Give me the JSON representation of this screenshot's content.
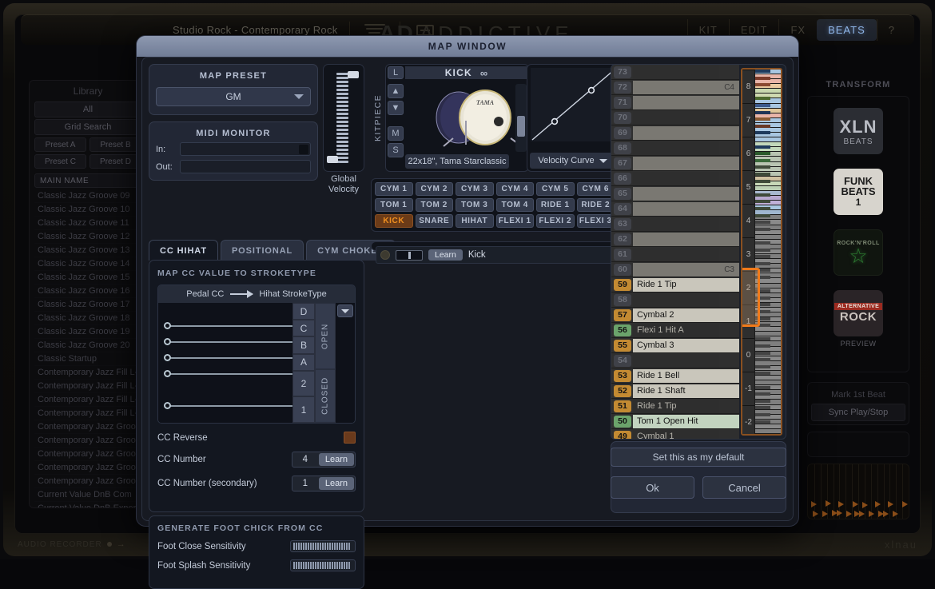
{
  "host_app": {
    "title": "Studio Rock - Contemporary Rock",
    "logo": "ADDICTIVE",
    "nav_tabs": [
      {
        "label": "KIT",
        "active": false
      },
      {
        "label": "EDIT",
        "active": false
      },
      {
        "label": "FX",
        "active": false
      },
      {
        "label": "BEATS",
        "active": true
      },
      {
        "label": "?",
        "active": false
      }
    ],
    "library": {
      "head": "Library",
      "all_button": "All",
      "grid_search": "Grid Search",
      "presets": [
        "Preset A",
        "Preset B",
        "Preset C",
        "Preset D"
      ],
      "column_header": "MAIN NAME",
      "items": [
        "Classic Jazz Groove 09",
        "Classic Jazz Groove 10",
        "Classic Jazz Groove 11",
        "Classic Jazz Groove 12",
        "Classic Jazz Groove 13",
        "Classic Jazz Groove 14",
        "Classic Jazz Groove 15",
        "Classic Jazz Groove 16",
        "Classic Jazz Groove 17",
        "Classic Jazz Groove 18",
        "Classic Jazz Groove 19",
        "Classic Jazz Groove 20",
        "Classic Startup",
        "Contemporary Jazz Fill L-",
        "Contemporary Jazz Fill L-",
        "Contemporary Jazz Fill L-",
        "Contemporary Jazz Fill L-",
        "Contemporary Jazz Groo",
        "Contemporary Jazz Groo",
        "Contemporary Jazz Groo",
        "Contemporary Jazz Groo",
        "Contemporary Jazz Groo",
        "Current Value DnB Com",
        "Current Value DnB Exper"
      ]
    },
    "transform": {
      "head": "TRANSFORM",
      "tiles": [
        {
          "line1": "XLN",
          "line2": "BEATS",
          "caption": ""
        },
        {
          "line1": "FUNK",
          "line2": "BEATS",
          "line3": "1",
          "caption": ""
        },
        {
          "line1": "ROCK'N'ROLL",
          "line2": "",
          "caption": ""
        },
        {
          "line1": "ALTERNATIVE",
          "line2": "ROCK",
          "caption": "PREVIEW"
        }
      ],
      "buttons": [
        "Mark 1st Beat",
        "Sync Play/Stop"
      ]
    },
    "statusbar": {
      "left": "AUDIO RECORDER",
      "right": "xlnau"
    }
  },
  "modal": {
    "title": "MAP WINDOW",
    "map_preset": {
      "title": "MAP PRESET",
      "selected": "GM"
    },
    "midi_monitor": {
      "title": "MIDI MONITOR",
      "in_label": "In:",
      "out_label": "Out:",
      "in_value": "",
      "out_value": ""
    },
    "global_velocity": {
      "label_line1": "Global",
      "label_line2": "Velocity"
    },
    "tabs": [
      {
        "label": "CC HIHAT",
        "active": true
      },
      {
        "label": "POSITIONAL",
        "active": false
      },
      {
        "label": "CYM CHOKES",
        "active": false
      }
    ],
    "cc_hihat": {
      "section_title": "MAP CC VALUE TO STROKETYPE",
      "header_left": "Pedal CC",
      "header_right": "Hihat StrokeType",
      "stroke_labels": [
        "D",
        "C",
        "B",
        "A",
        "2",
        "1"
      ],
      "group_open": "OPEN",
      "group_closed": "CLOSED",
      "cc_reverse_label": "CC Reverse",
      "cc_reverse_checked": true,
      "cc_number_label": "CC Number",
      "cc_number_value": "4",
      "cc_number_learn": "Learn",
      "cc_number_secondary_label": "CC Number (secondary)",
      "cc_number_secondary_value": "1",
      "cc_number_secondary_learn": "Learn"
    },
    "foot_chick": {
      "section_title": "GENERATE FOOT CHICK FROM CC",
      "rows": [
        {
          "label": "Foot Close Sensitivity"
        },
        {
          "label": "Foot Splash Sensitivity"
        }
      ]
    },
    "kitpiece": {
      "side_label": "KITPIECE",
      "name": "KICK",
      "caption": "22x18\", Tama Starclassic",
      "btn_l": "L",
      "btn_m": "M",
      "btn_s": "S"
    },
    "velocity_curve": {
      "label": "Velocity Curve"
    },
    "kit_grid": [
      [
        {
          "label": "CYM 1",
          "selected": false
        },
        {
          "label": "CYM 2",
          "selected": false
        },
        {
          "label": "CYM 3",
          "selected": false
        },
        {
          "label": "CYM 4",
          "selected": false
        },
        {
          "label": "CYM 5",
          "selected": false
        },
        {
          "label": "CYM 6",
          "selected": false
        }
      ],
      [
        {
          "label": "TOM 1",
          "selected": false
        },
        {
          "label": "TOM 2",
          "selected": false
        },
        {
          "label": "TOM 3",
          "selected": false
        },
        {
          "label": "TOM 4",
          "selected": false
        },
        {
          "label": "RIDE 1",
          "selected": false
        },
        {
          "label": "RIDE 2",
          "selected": false
        }
      ],
      [
        {
          "label": "KICK",
          "selected": true
        },
        {
          "label": "SNARE",
          "selected": false
        },
        {
          "label": "HIHAT",
          "selected": false
        },
        {
          "label": "FLEXI 1",
          "selected": false
        },
        {
          "label": "FLEXI 2",
          "selected": false
        },
        {
          "label": "FLEXI 3",
          "selected": false
        }
      ]
    ],
    "map_rows": [
      {
        "learn": "Learn",
        "name": "Kick"
      }
    ],
    "keymap": {
      "octave_marks": [
        "8",
        "7",
        "6",
        "5",
        "4",
        "3",
        "2",
        "1",
        "0",
        "-1",
        "-2"
      ],
      "selected_octave": "3",
      "octave_labels_in_list": [
        {
          "note": 72,
          "label": "C4"
        },
        {
          "note": 60,
          "label": "C3"
        }
      ],
      "rows": [
        {
          "note": 73,
          "name": "",
          "type": "black",
          "num_style": "off"
        },
        {
          "note": 72,
          "name": "",
          "type": "white",
          "num_style": "off"
        },
        {
          "note": 71,
          "name": "",
          "type": "white",
          "num_style": "off"
        },
        {
          "note": 70,
          "name": "",
          "type": "black",
          "num_style": "off"
        },
        {
          "note": 69,
          "name": "",
          "type": "white",
          "num_style": "off"
        },
        {
          "note": 68,
          "name": "",
          "type": "black",
          "num_style": "off"
        },
        {
          "note": 67,
          "name": "",
          "type": "white",
          "num_style": "off"
        },
        {
          "note": 66,
          "name": "",
          "type": "black",
          "num_style": "off"
        },
        {
          "note": 65,
          "name": "",
          "type": "white",
          "num_style": "off"
        },
        {
          "note": 64,
          "name": "",
          "type": "white",
          "num_style": "off"
        },
        {
          "note": 63,
          "name": "",
          "type": "black",
          "num_style": "off"
        },
        {
          "note": 62,
          "name": "",
          "type": "white",
          "num_style": "off"
        },
        {
          "note": 61,
          "name": "",
          "type": "black",
          "num_style": "off"
        },
        {
          "note": 60,
          "name": "",
          "type": "white",
          "num_style": "off"
        },
        {
          "note": 59,
          "name": "Ride 1 Tip",
          "type": "white",
          "num_style": "tan"
        },
        {
          "note": 58,
          "name": "",
          "type": "black",
          "num_style": "off"
        },
        {
          "note": 57,
          "name": "Cymbal 2",
          "type": "white",
          "num_style": "tan"
        },
        {
          "note": 56,
          "name": "Flexi 1 Hit A",
          "type": "black",
          "num_style": "green"
        },
        {
          "note": 55,
          "name": "Cymbal 3",
          "type": "white",
          "num_style": "tan"
        },
        {
          "note": 54,
          "name": "",
          "type": "black",
          "num_style": "off"
        },
        {
          "note": 53,
          "name": "Ride 1 Bell",
          "type": "white",
          "num_style": "tan"
        },
        {
          "note": 52,
          "name": "Ride 1 Shaft",
          "type": "white",
          "num_style": "tan"
        },
        {
          "note": 51,
          "name": "Ride 1 Tip",
          "type": "black",
          "num_style": "tan"
        },
        {
          "note": 50,
          "name": "Tom 1 Open Hit",
          "type": "greenish",
          "num_style": "green"
        },
        {
          "note": 49,
          "name": "Cymbal 1",
          "type": "black",
          "num_style": "tan"
        }
      ]
    },
    "set_default_button": "Set this as my default",
    "ok_button": "Ok",
    "cancel_button": "Cancel"
  }
}
